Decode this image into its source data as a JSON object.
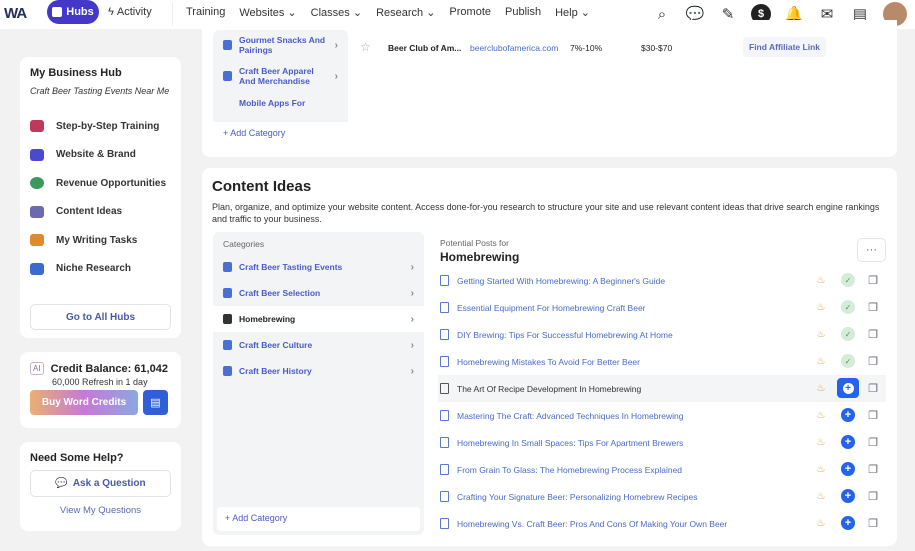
{
  "nav": {
    "logo": "WA",
    "hubs": "Hubs",
    "activity": "Activity",
    "menu": [
      "Training",
      "Websites ⌄",
      "Classes ⌄",
      "Research ⌄",
      "Promote",
      "Publish",
      "Help ⌄"
    ],
    "icons": [
      "search-icon",
      "chat-icon",
      "pencil-icon",
      "dollar-icon",
      "bell-icon",
      "mail-icon",
      "store-icon"
    ]
  },
  "sidebar": {
    "title": "My Business Hub",
    "subtitle": "Craft Beer Tasting Events Near Me",
    "items": [
      {
        "label": "Step-by-Step Training",
        "color": "#c0395a"
      },
      {
        "label": "Website & Brand",
        "color": "#4a4ad0"
      },
      {
        "label": "Revenue Opportunities",
        "color": "#3a9a5a"
      },
      {
        "label": "Content Ideas",
        "color": "#6a6ab0"
      },
      {
        "label": "My Writing Tasks",
        "color": "#e08a30"
      },
      {
        "label": "Niche Research",
        "color": "#3a6ad0"
      }
    ],
    "all_hubs": "Go to All Hubs"
  },
  "credits": {
    "ai": "AI",
    "balance": "Credit Balance: 61,042",
    "refresh": "60,000 Refresh in 1 day",
    "buy": "Buy Word Credits"
  },
  "help": {
    "title": "Need Some Help?",
    "ask": "Ask a Question",
    "view": "View My Questions"
  },
  "top": {
    "categories": [
      "Gourmet Snacks And Pairings",
      "Craft Beer Apparel And Merchandise",
      "Mobile Apps For"
    ],
    "add": "Add Category",
    "row": {
      "name": "Beer Club of Am...",
      "url": "beerclubofamerica.com",
      "commission": "7%-10%",
      "price": "$30-$70",
      "action": "Find Affiliate Link"
    }
  },
  "content": {
    "title": "Content Ideas",
    "desc": "Plan, organize, and optimize your website content. Access done-for-you research to structure your site and use relevant content ideas that drive search engine rankings and traffic to your business.",
    "categories_label": "Categories",
    "categories": [
      "Craft Beer Tasting Events",
      "Craft Beer Selection",
      "Homebrewing",
      "Craft Beer Culture",
      "Craft Beer History"
    ],
    "selected": "Homebrewing",
    "add": "Add Category",
    "posts_label": "Potential Posts for",
    "posts_topic": "Homebrewing",
    "more": "···",
    "posts": [
      {
        "title": "Getting Started With Homebrewing: A Beginner's Guide",
        "added": true
      },
      {
        "title": "Essential Equipment For Homebrewing Craft Beer",
        "added": true
      },
      {
        "title": "DIY Brewing: Tips For Successful Homebrewing At Home",
        "added": true
      },
      {
        "title": "Homebrewing Mistakes To Avoid For Better Beer",
        "added": true
      },
      {
        "title": "The Art Of Recipe Development In Homebrewing",
        "added": false
      },
      {
        "title": "Mastering The Craft: Advanced Techniques In Homebrewing",
        "added": false
      },
      {
        "title": "Homebrewing In Small Spaces: Tips For Apartment Brewers",
        "added": false
      },
      {
        "title": "From Grain To Glass: The Homebrewing Process Explained",
        "added": false
      },
      {
        "title": "Crafting Your Signature Beer: Personalizing Homebrew Recipes",
        "added": false
      },
      {
        "title": "Homebrewing Vs. Craft Beer: Pros And Cons Of Making Your Own Beer",
        "added": false
      }
    ]
  }
}
